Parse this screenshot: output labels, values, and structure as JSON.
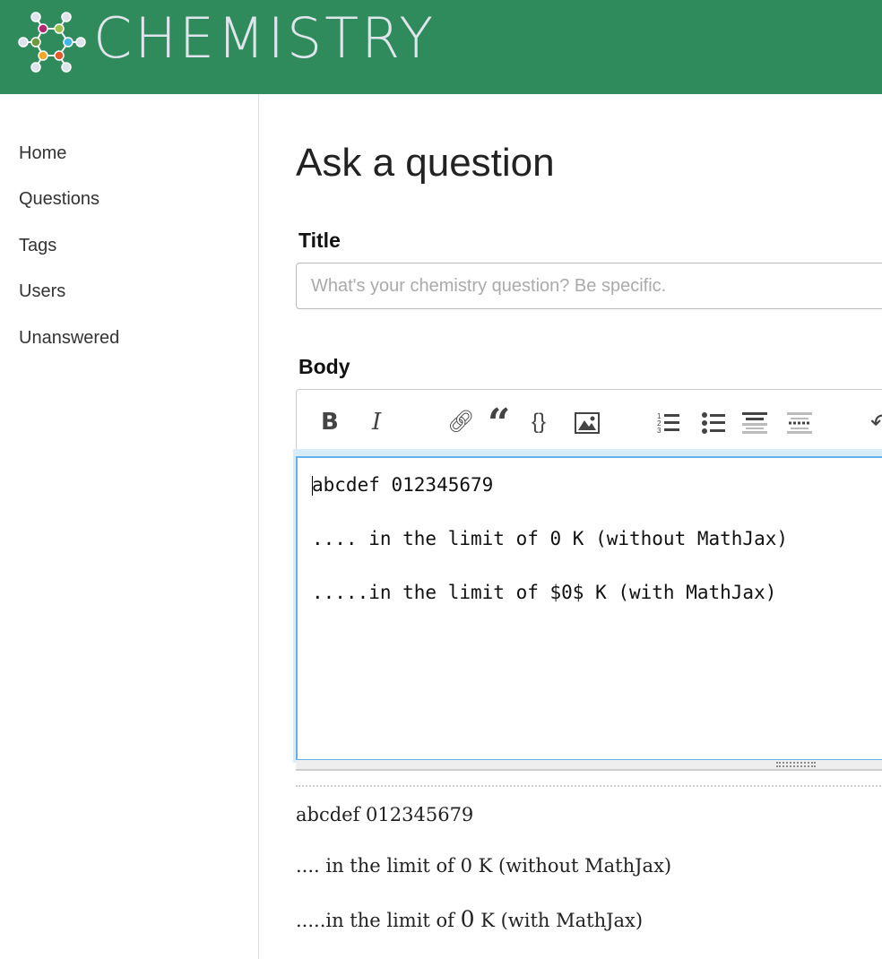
{
  "header": {
    "logo_text": "CHEMISTRY",
    "brand_color": "#2f8a5c"
  },
  "sidebar": {
    "items": [
      {
        "label": "Home"
      },
      {
        "label": "Questions"
      },
      {
        "label": "Tags"
      },
      {
        "label": "Users"
      },
      {
        "label": "Unanswered"
      }
    ]
  },
  "main": {
    "page_title": "Ask a question",
    "title_label": "Title",
    "title_placeholder": "What's your chemistry question? Be specific.",
    "body_label": "Body",
    "toolbar": {
      "bold": "B",
      "italic": "I",
      "link": "link-icon",
      "quote": "quote-icon",
      "code": "code-icon",
      "image": "image-icon",
      "ordered_list": "ordered-list-icon",
      "bullet_list": "bullet-list-icon",
      "heading": "heading-icon",
      "hr": "horizontal-rule-icon",
      "undo": "undo-icon"
    },
    "body_lines": [
      "abcdef 012345679",
      ".... in the limit of 0 K (without MathJax)",
      ".....in the limit of $0$ K (with MathJax)"
    ],
    "preview": {
      "line1": "abcdef 012345679",
      "line2": ".... in the limit of 0 K (without MathJax)",
      "line3_prefix": ".....in the limit of ",
      "line3_math": "0",
      "line3_suffix": " K (with MathJax)"
    }
  }
}
